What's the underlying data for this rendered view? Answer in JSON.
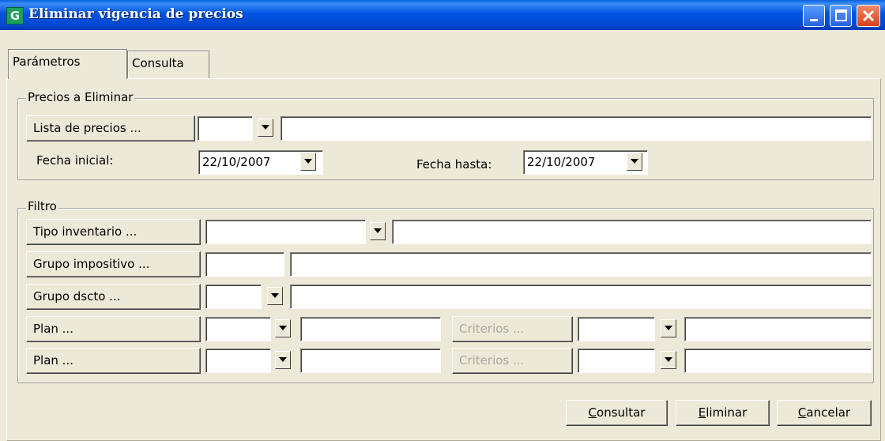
{
  "window": {
    "title": "Eliminar vigencia de precios",
    "app_icon_glyph": "G"
  },
  "tabs": [
    {
      "label": "Parámetros",
      "active": true
    },
    {
      "label": "Consulta",
      "active": false
    }
  ],
  "precios": {
    "legend": "Precios a Eliminar",
    "lista_button": "Lista de precios ...",
    "lista_code": "",
    "lista_desc": "",
    "fecha_inicial_label": "Fecha inicial:",
    "fecha_inicial_value": "22/10/2007",
    "fecha_hasta_label": "Fecha hasta:",
    "fecha_hasta_value": "22/10/2007"
  },
  "filtro": {
    "legend": "Filtro",
    "tipo_inventario_button": "Tipo inventario ...",
    "grupo_impositivo_button": "Grupo impositivo ...",
    "grupo_dscto_button": "Grupo dscto ...",
    "plan_button_1": "Plan ...",
    "plan_button_2": "Plan ...",
    "criterios_button_1": "Criterios ...",
    "criterios_button_2": "Criterios ..."
  },
  "actions": {
    "consultar_hotkey": "C",
    "consultar_rest": "onsultar",
    "eliminar_hotkey": "E",
    "eliminar_rest": "liminar",
    "cancelar_hotkey": "C",
    "cancelar_rest": "ancelar"
  },
  "colors": {
    "titlebar": "#0053E0",
    "face": "#ECE9D8",
    "close_button": "#D8401C"
  }
}
